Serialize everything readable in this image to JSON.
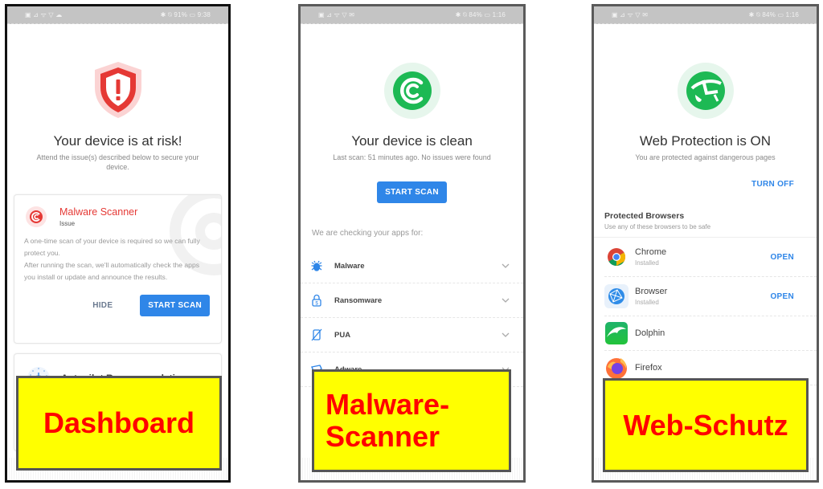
{
  "screens": [
    {
      "id": "dashboard",
      "status_bar": {
        "left": "▣ ⊿ ᯤ ▽ ☁",
        "right": "✱ ⍉ 91% ▭ 9:38"
      },
      "hero": {
        "icon": "shield-alert-icon",
        "title": "Your device is at risk!",
        "subtitle": "Attend the issue(s) described below to secure your device."
      },
      "malware_card": {
        "icon": "malware-scanner-icon",
        "title": "Malware Scanner",
        "tag": "Issue",
        "body_lines": [
          "A one-time scan of your device is required so we can fully protect you.",
          "After running the scan, we'll automatically check the apps you install or update and announce the results."
        ],
        "hide_label": "HIDE",
        "start_label": "START SCAN"
      },
      "autopilot_card": {
        "icon": "autopilot-icon",
        "title": "Autopilot Recommendations"
      },
      "overlay_label": "Dashboard"
    },
    {
      "id": "malware-scanner",
      "status_bar": {
        "left": "▣ ⊿ ᯤ ▽ ✉",
        "right": "✱ ⍉ 84% ▭ 1:16"
      },
      "hero": {
        "icon": "scanner-clean-icon",
        "title": "Your device is clean",
        "subtitle": "Last scan: 51 minutes ago. No issues were found"
      },
      "start_label": "START SCAN",
      "checking_label": "We are checking your apps for:",
      "threats": [
        {
          "name": "Malware",
          "icon": "bug-icon"
        },
        {
          "name": "Ransomware",
          "icon": "lock-dollar-icon"
        },
        {
          "name": "PUA",
          "icon": "phone-crossed-icon"
        },
        {
          "name": "Adware",
          "icon": "megaphone-icon"
        }
      ],
      "overlay_label_lines": [
        "Malware-",
        "Scanner"
      ]
    },
    {
      "id": "web-protection",
      "status_bar": {
        "left": "▣ ⊿ ᯤ ▽ ✉",
        "right": "✱ ⍉ 84% ▭ 1:16"
      },
      "hero": {
        "icon": "web-protection-globe-icon",
        "title": "Web Protection is ON",
        "subtitle": "You are protected against dangerous pages"
      },
      "turn_off_label": "TURN OFF",
      "browsers_title": "Protected Browsers",
      "browsers_subtitle": "Use any of these browsers to be safe",
      "browsers": [
        {
          "name": "Chrome",
          "status": "Installed",
          "action": "OPEN",
          "icon": "chrome-icon"
        },
        {
          "name": "Browser",
          "status": "Installed",
          "action": "OPEN",
          "icon": "browser-globe-icon"
        },
        {
          "name": "Dolphin",
          "status": "",
          "action": "",
          "icon": "dolphin-icon"
        },
        {
          "name": "Firefox",
          "status": "",
          "action": "",
          "icon": "firefox-icon"
        }
      ],
      "overlay_label": "Web-Schutz"
    }
  ],
  "colors": {
    "danger": "#e53935",
    "success": "#1db954",
    "primary": "#2f86e8",
    "label_bg": "#ffff00",
    "label_text": "#ff0000"
  }
}
